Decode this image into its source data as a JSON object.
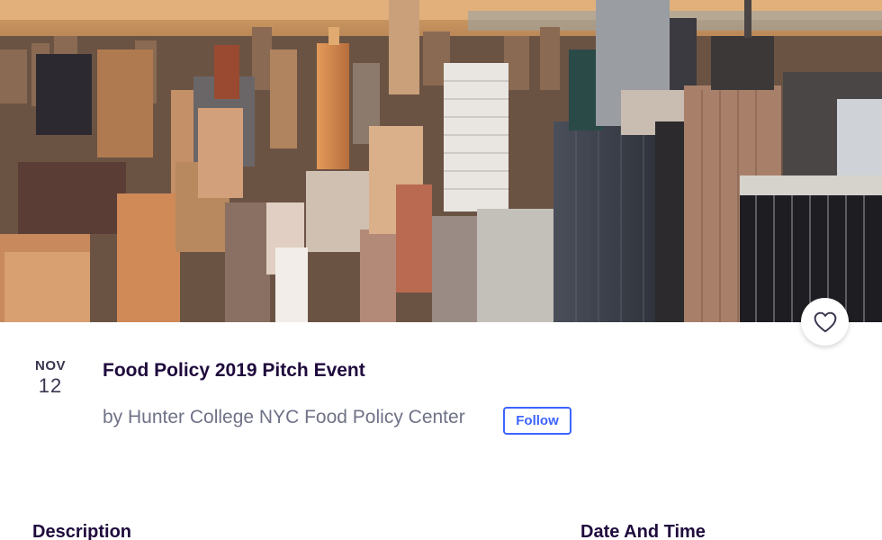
{
  "hero": {
    "image_subject": "Aerial view of New York City skyline at sunset"
  },
  "like": {
    "icon": "heart-outline-icon"
  },
  "event": {
    "month": "NOV",
    "day": "12",
    "title": "Food Policy 2019 Pitch Event",
    "organizer": "by Hunter College NYC Food Policy Center",
    "follow_label": "Follow"
  },
  "sections": {
    "description": "Description",
    "date_time": "Date And Time"
  },
  "colors": {
    "accent": "#3d64ff",
    "title": "#1e0a3c",
    "muted": "#6f7287"
  }
}
